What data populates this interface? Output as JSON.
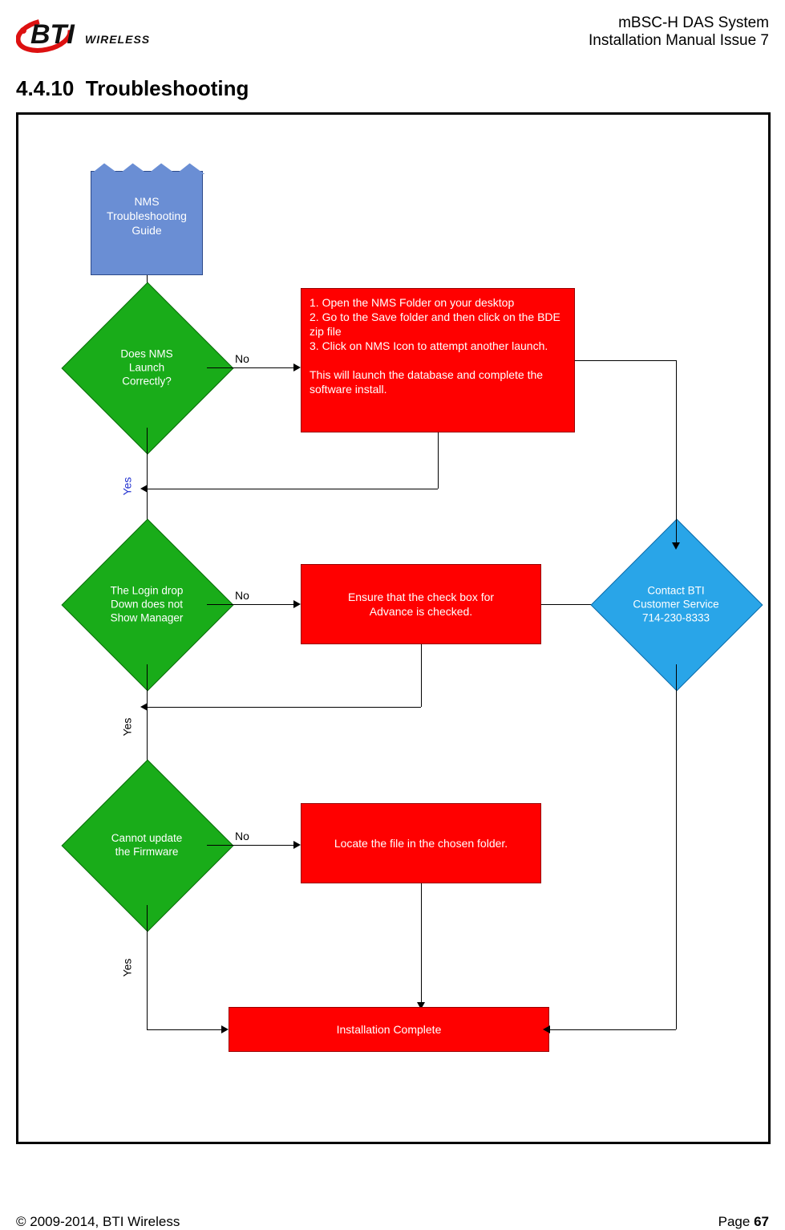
{
  "header": {
    "logo_text": "BTI",
    "logo_sub": "WIRELESS",
    "line1": "mBSC-H DAS System",
    "line2": "Installation Manual Issue 7"
  },
  "section": {
    "number": "4.4.10",
    "title": "Troubleshooting"
  },
  "flow": {
    "start_doc": "NMS\nTroubleshooting\nGuide",
    "d1": "Does NMS\nLaunch\nCorrectly?",
    "d2": "The Login drop\nDown does not\nShow Manager",
    "d3": "Cannot update\nthe Firmware",
    "contact": "Contact BTI\nCustomer Service\n714-230-8333",
    "r1": "1. Open the NMS Folder on your desktop\n2. Go to the Save folder and then click on the BDE  zip file\n3. Click on NMS Icon to attempt another launch.\n\nThis will launch the database and complete the software install.",
    "r2": "Ensure that the check box for\nAdvance is checked.",
    "r3": "Locate the file in the chosen folder.",
    "r4": "Installation Complete",
    "labels": {
      "no": "No",
      "yes": "Yes"
    }
  },
  "footer": {
    "copyright": "© 2009-2014, BTI Wireless",
    "page_label": "Page ",
    "page_num": "67"
  }
}
